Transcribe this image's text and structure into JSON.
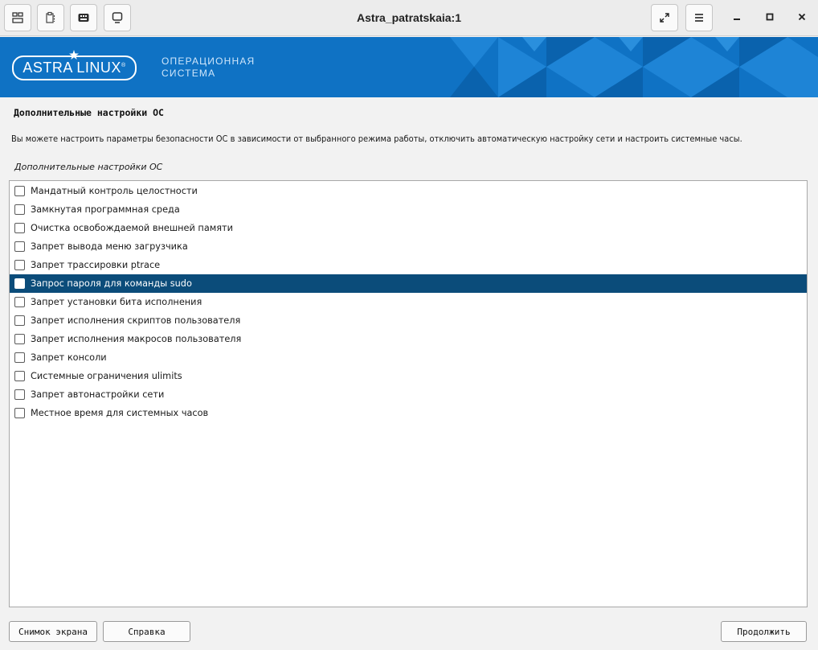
{
  "window": {
    "title": "Astra_patratskaia:1",
    "toolbar_icons": [
      "layout-icon",
      "clipboard-icon",
      "keyboard-icon",
      "display-icon"
    ],
    "controls": [
      "fullscreen-icon",
      "menu-icon",
      "minimize-icon",
      "maximize-icon",
      "close-icon"
    ]
  },
  "banner": {
    "logo_text": "ASTRA LINUX",
    "logo_mark": "®",
    "subtitle_line1": "ОПЕРАЦИОННАЯ",
    "subtitle_line2": "СИСТЕМА",
    "colors": {
      "background": "#0f72c4",
      "pattern": "#1f86d6"
    }
  },
  "page": {
    "title": "Дополнительные настройки ОС",
    "description": "Вы можете настроить параметры безопасности ОС в зависимости от выбранного режима работы, отключить автоматическую настройку сети и настроить системные часы.",
    "list_caption": "Дополнительные настройки ОС"
  },
  "options": [
    {
      "label": "Мандатный контроль целостности",
      "checked": false,
      "selected": false
    },
    {
      "label": "Замкнутая программная среда",
      "checked": false,
      "selected": false
    },
    {
      "label": "Очистка освобождаемой внешней памяти",
      "checked": false,
      "selected": false
    },
    {
      "label": "Запрет вывода меню загрузчика",
      "checked": false,
      "selected": false
    },
    {
      "label": "Запрет трассировки ptrace",
      "checked": false,
      "selected": false
    },
    {
      "label": "Запрос пароля для команды sudo",
      "checked": false,
      "selected": true
    },
    {
      "label": "Запрет установки бита исполнения",
      "checked": false,
      "selected": false
    },
    {
      "label": "Запрет исполнения скриптов пользователя",
      "checked": false,
      "selected": false
    },
    {
      "label": "Запрет исполнения макросов пользователя",
      "checked": false,
      "selected": false
    },
    {
      "label": "Запрет консоли",
      "checked": false,
      "selected": false
    },
    {
      "label": "Системные ограничения ulimits",
      "checked": false,
      "selected": false
    },
    {
      "label": "Запрет автонастройки сети",
      "checked": false,
      "selected": false
    },
    {
      "label": "Местное время для системных часов",
      "checked": false,
      "selected": false
    }
  ],
  "buttons": {
    "screenshot": "Снимок экрана",
    "help": "Справка",
    "continue": "Продолжить"
  },
  "colors": {
    "selection": "#0b4c7a"
  }
}
